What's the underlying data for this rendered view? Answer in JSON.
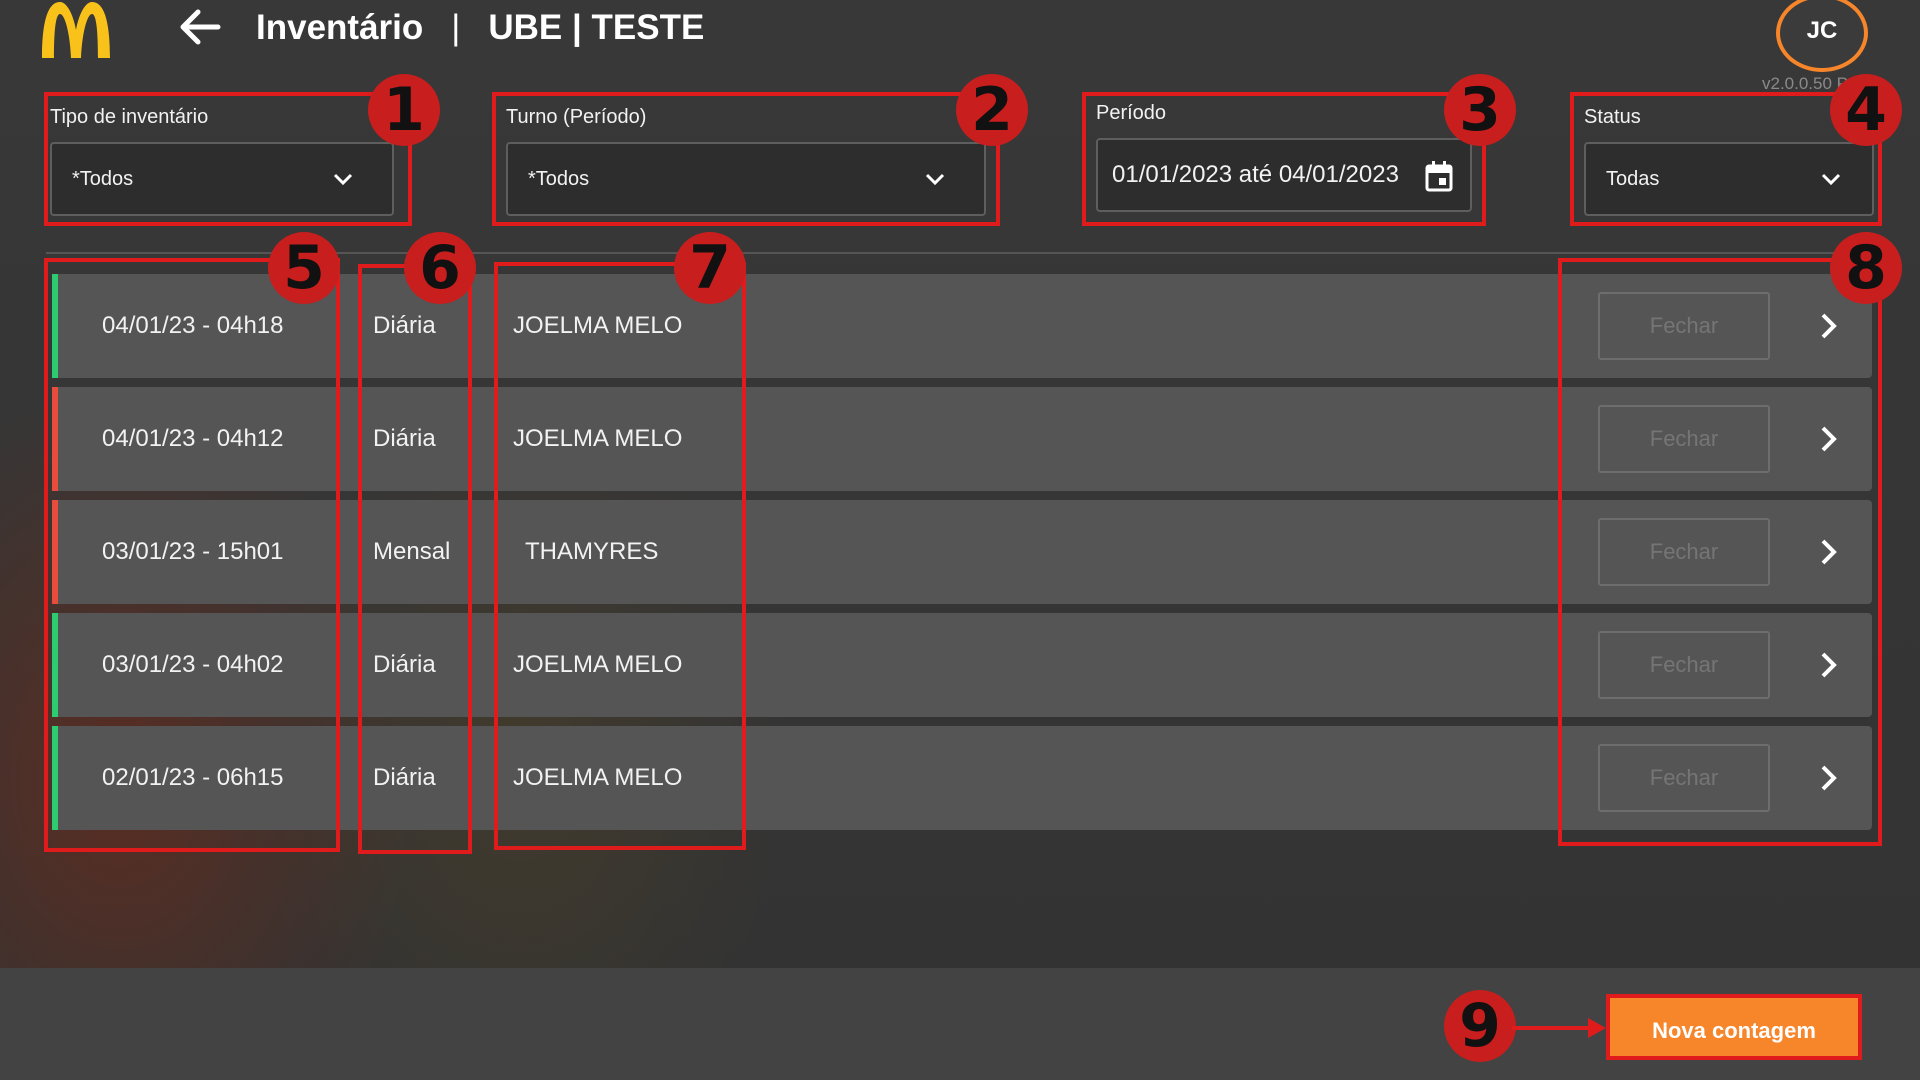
{
  "header": {
    "logo_icon": "mcdonalds-arches-logo",
    "back_icon": "arrow-left-icon",
    "title_left": "Inventário",
    "title_separator": "|",
    "title_right": "UBE | TESTE",
    "avatar_initials": "JC",
    "version": "v2.0.0.50 Prod"
  },
  "filters": {
    "inventory_type": {
      "label": "Tipo de inventário",
      "value": "*Todos"
    },
    "shift": {
      "label": "Turno (Período)",
      "value": "*Todos"
    },
    "period": {
      "label": "Período",
      "value": "01/01/2023 até 04/01/2023",
      "icon": "calendar-icon"
    },
    "status": {
      "label": "Status",
      "value": "Todas"
    }
  },
  "rows": [
    {
      "date": "04/01/23 - 04h18",
      "type": "Diária",
      "user": "JOELMA MELO",
      "status_color": "#2ecc71",
      "action": "Fechar"
    },
    {
      "date": "04/01/23 - 04h12",
      "type": "Diária",
      "user": "JOELMA MELO",
      "status_color": "#e74c3c",
      "action": "Fechar"
    },
    {
      "date": "03/01/23 - 15h01",
      "type": "Mensal",
      "user": "THAMYRES",
      "status_color": "#e74c3c",
      "action": "Fechar"
    },
    {
      "date": "03/01/23 - 04h02",
      "type": "Diária",
      "user": "JOELMA MELO",
      "status_color": "#2ecc71",
      "action": "Fechar"
    },
    {
      "date": "02/01/23 - 06h15",
      "type": "Diária",
      "user": "JOELMA MELO",
      "status_color": "#2ecc71",
      "action": "Fechar"
    }
  ],
  "footer": {
    "new_count_button": "Nova contagem"
  },
  "annotations": [
    "1",
    "2",
    "3",
    "4",
    "5",
    "6",
    "7",
    "8",
    "9"
  ],
  "colors": {
    "accent": "#f7852a",
    "annotation": "#e01b1b",
    "row_bg": "#555555"
  }
}
